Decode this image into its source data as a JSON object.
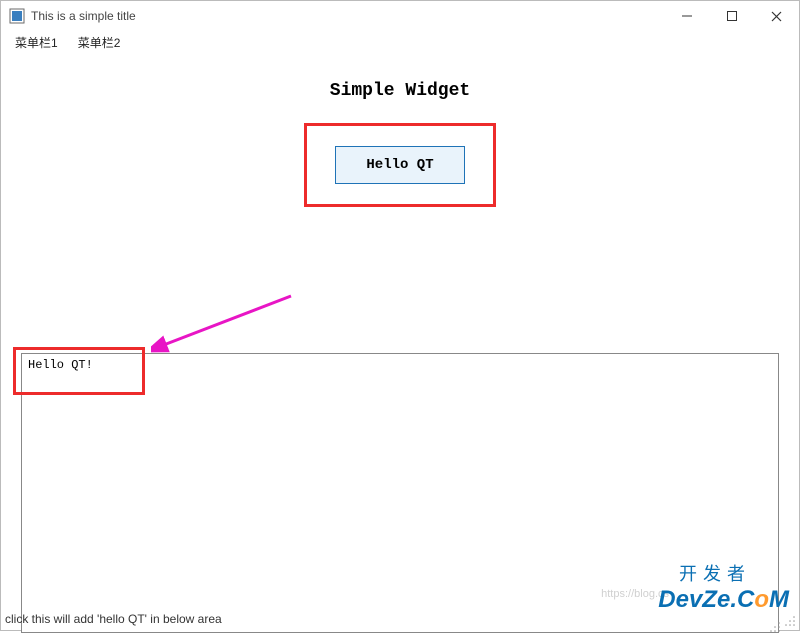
{
  "window": {
    "title": "This is a simple title"
  },
  "menu": {
    "items": [
      "菜单栏1",
      "菜单栏2"
    ]
  },
  "main": {
    "heading": "Simple Widget",
    "button_label": "Hello QT",
    "textarea_content": "Hello QT!"
  },
  "status": {
    "text": "click this will add 'hello QT' in below area"
  },
  "watermark": {
    "faint": "https://blog.cs",
    "cn": "开发者",
    "latin_pre": "DevZe.C",
    "latin_o": "o",
    "latin_post": "M"
  },
  "colors": {
    "highlight_border": "#ed2b2b",
    "button_border": "#1f73b7",
    "button_bg": "#e9f3fb",
    "arrow": "#e815c5",
    "brand_blue": "#0a6fb3",
    "brand_orange": "#ff9a2e"
  }
}
